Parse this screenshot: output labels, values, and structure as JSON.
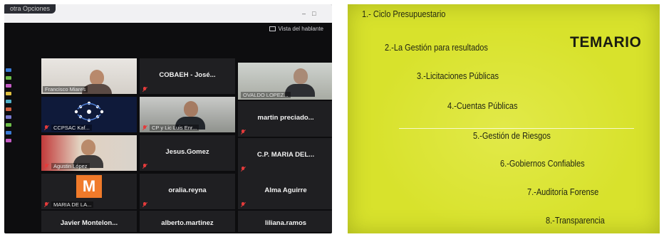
{
  "call": {
    "meeting_label": "otra Opciones",
    "speaker_view_label": "Vista del hablante",
    "window_buttons": [
      "–",
      "□"
    ],
    "participants": [
      {
        "name": "Francisco Miares",
        "type": "video"
      },
      {
        "name": "COBAEH - José...",
        "type": "name"
      },
      {
        "name": "OVALDO LOPEZ...",
        "type": "video",
        "active": true
      },
      {
        "name": "CCPSAC Kaf...",
        "type": "logo"
      },
      {
        "name": "CP y Lic Luis Enr...",
        "type": "video"
      },
      {
        "name": "martin preciado...",
        "type": "name"
      },
      {
        "name": "Agustin López",
        "type": "video"
      },
      {
        "name": "Jesus.Gomez",
        "type": "name"
      },
      {
        "name": "C.P. MARIA DEL...",
        "type": "name"
      },
      {
        "name": "MARIA DE LA...",
        "type": "avatar",
        "initial": "M"
      },
      {
        "name": "oralia.reyna",
        "type": "name"
      },
      {
        "name": "Alma Aguirre",
        "type": "name"
      },
      {
        "name": "Javier Montelon...",
        "type": "name"
      },
      {
        "name": "alberto.martinez",
        "type": "name"
      },
      {
        "name": "liliana.ramos",
        "type": "name"
      }
    ],
    "colors": {
      "active_border": "#b6d04a",
      "muted_mic": "#e43b3b",
      "avatar_bg": "#f07a2a"
    }
  },
  "slide": {
    "title": "TEMARIO",
    "items": [
      "1.- Ciclo Presupuestario",
      "2.-La Gestión para resultados",
      "3.-Licitaciones Públicas",
      "4.-Cuentas Públicas",
      "5.-Gestión de Riesgos",
      "6.-Gobiernos Confiables",
      "7.-Auditoría Forense",
      "8.-Transparencia"
    ],
    "colors": {
      "background": "#d8e22c",
      "text": "#1f2312"
    }
  }
}
